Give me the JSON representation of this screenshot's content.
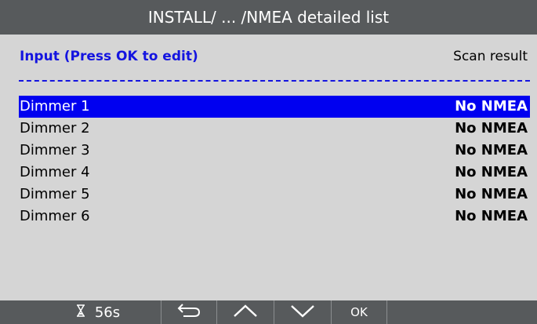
{
  "title": "INSTALL/ ... /NMEA detailed list",
  "header": {
    "left": "Input (Press OK to edit)",
    "right": "Scan result"
  },
  "rows": [
    {
      "name": "Dimmer 1",
      "status": "No NMEA",
      "selected": true
    },
    {
      "name": "Dimmer 2",
      "status": "No NMEA",
      "selected": false
    },
    {
      "name": "Dimmer 3",
      "status": "No NMEA",
      "selected": false
    },
    {
      "name": "Dimmer 4",
      "status": "No NMEA",
      "selected": false
    },
    {
      "name": "Dimmer 5",
      "status": "No NMEA",
      "selected": false
    },
    {
      "name": "Dimmer 6",
      "status": "No NMEA",
      "selected": false
    }
  ],
  "bottom_bar": {
    "timer_icon": "hourglass-icon",
    "timer": "56s",
    "back_icon": "back-arrow-icon",
    "up_icon": "chevron-up-icon",
    "down_icon": "chevron-down-icon",
    "ok_label": "OK"
  },
  "colors": {
    "bar_background": "#575a5c",
    "screen_background": "#d5d5d5",
    "accent_blue": "#1414e0",
    "selection": "#0000f0"
  }
}
